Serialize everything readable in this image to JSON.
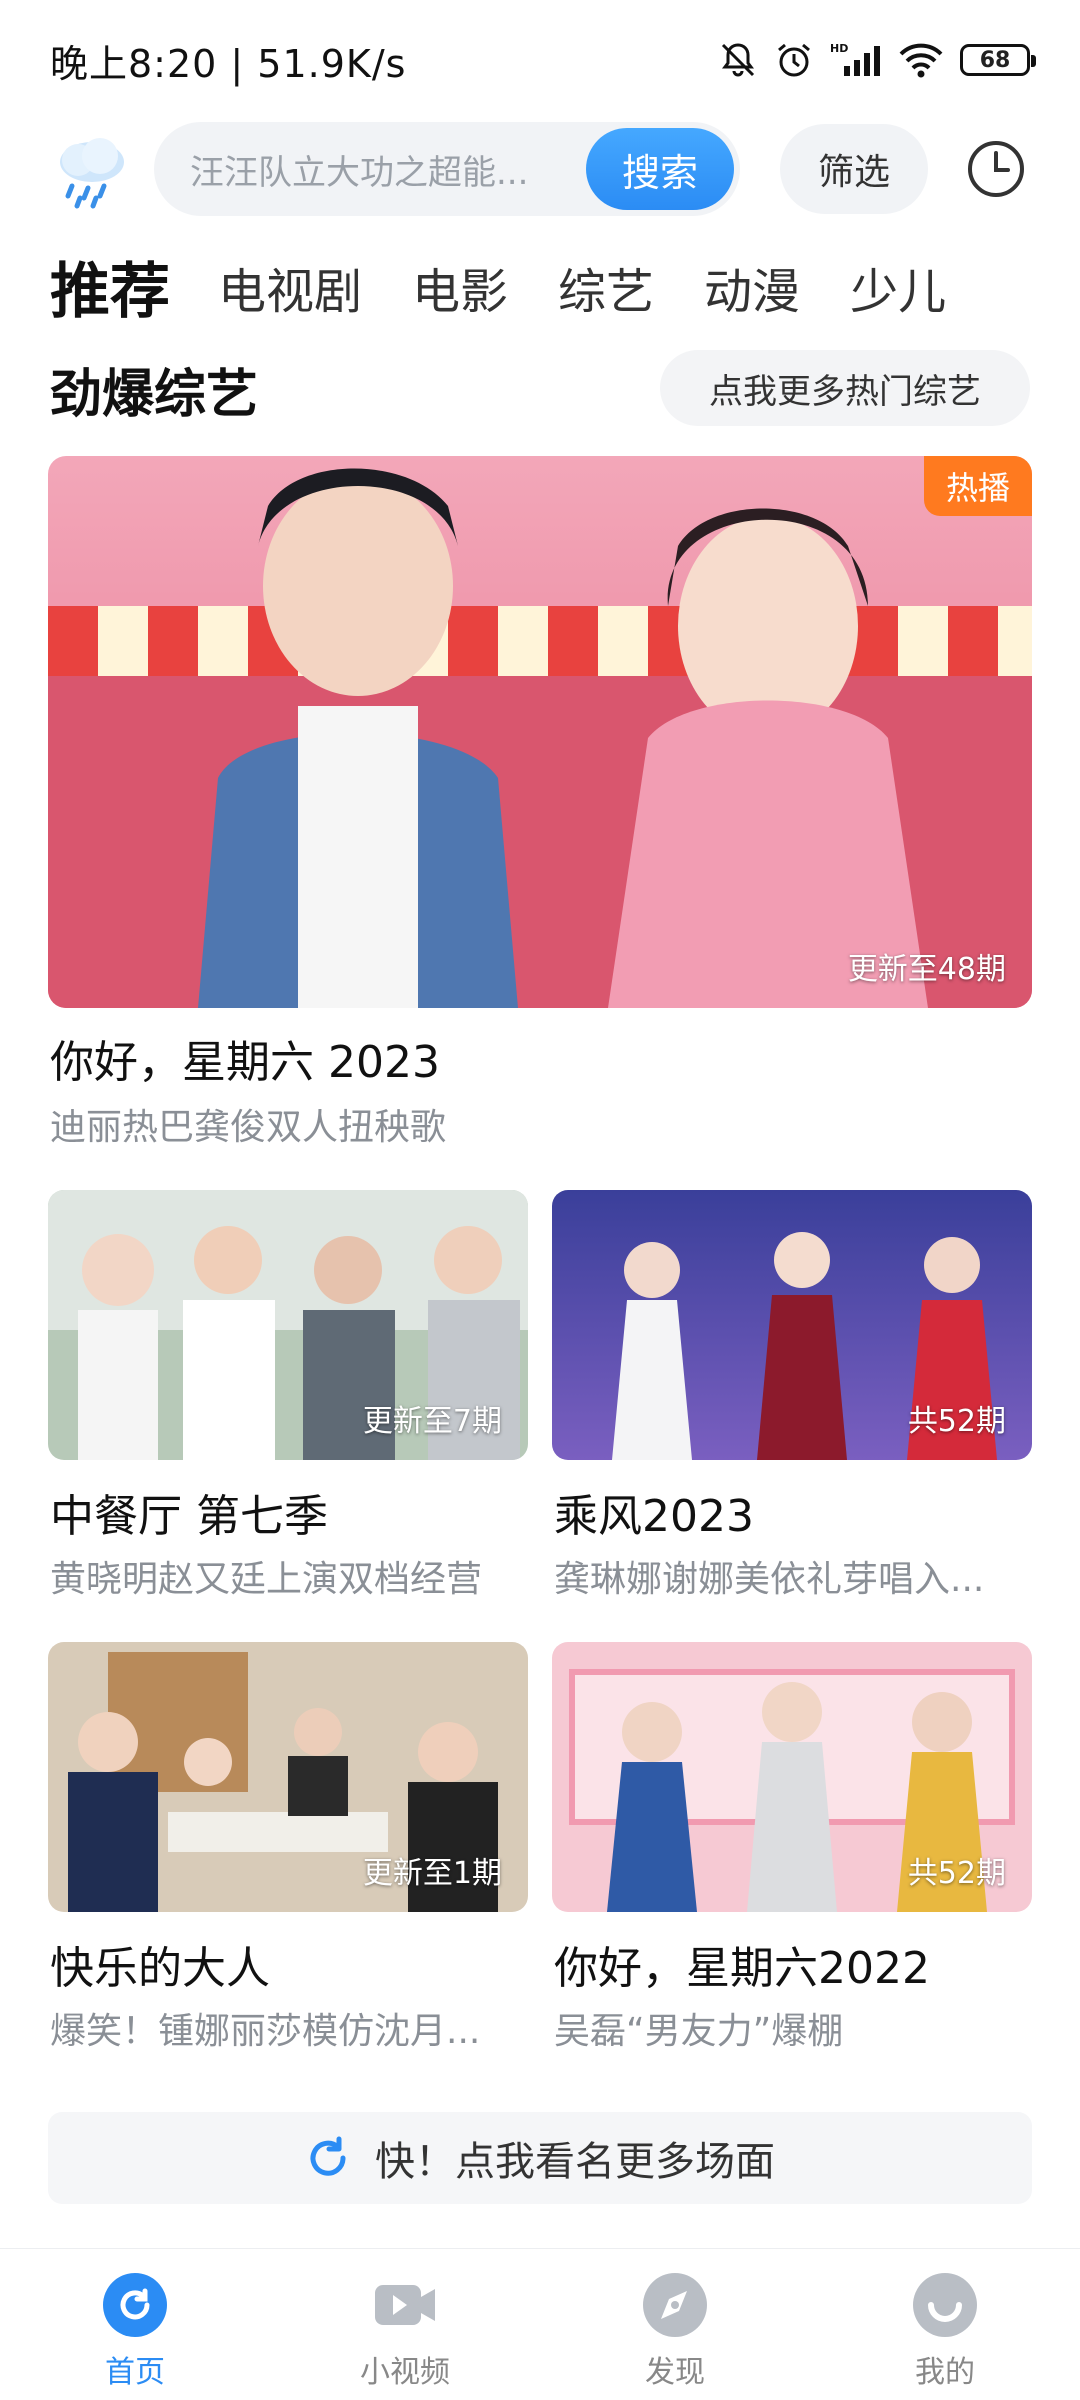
{
  "status": {
    "time_speed": "晚上8:20 | 51.9K/s",
    "battery": "68"
  },
  "search": {
    "placeholder": "汪汪队立大功之超能...",
    "button": "搜索",
    "filter": "筛选"
  },
  "tabs": [
    {
      "label": "推荐",
      "active": true
    },
    {
      "label": "电视剧"
    },
    {
      "label": "电影"
    },
    {
      "label": "综艺"
    },
    {
      "label": "动漫"
    },
    {
      "label": "少儿"
    }
  ],
  "section": {
    "title": "劲爆综艺",
    "more": "点我更多热门综艺"
  },
  "hero": {
    "badge": "热播",
    "episode": "更新至48期",
    "title": "你好，星期六 2023",
    "subtitle": "迪丽热巴龚俊双人扭秧歌"
  },
  "cards": [
    {
      "episode": "更新至7期",
      "title": "中餐厅 第七季",
      "subtitle": "黄晓明赵又廷上演双档经营"
    },
    {
      "episode": "共52期",
      "title": "乘风2023",
      "subtitle": "龚琳娜谢娜美依礼芽唱入..."
    },
    {
      "episode": "更新至1期",
      "title": "快乐的大人",
      "subtitle": "爆笑！锺娜丽莎模仿沈月..."
    },
    {
      "episode": "共52期",
      "title": "你好，星期六2022",
      "subtitle": "吴磊“男友力”爆棚"
    }
  ],
  "more_button": "快！点我看名更多场面",
  "nav": [
    {
      "label": "首页",
      "icon": "home-refresh-icon",
      "active": true
    },
    {
      "label": "小视频",
      "icon": "video-icon"
    },
    {
      "label": "发现",
      "icon": "compass-icon"
    },
    {
      "label": "我的",
      "icon": "profile-icon"
    }
  ],
  "colors": {
    "accent": "#2b8cf4",
    "hot_badge": "#ff7a1f",
    "subtext": "#8a8f96"
  }
}
